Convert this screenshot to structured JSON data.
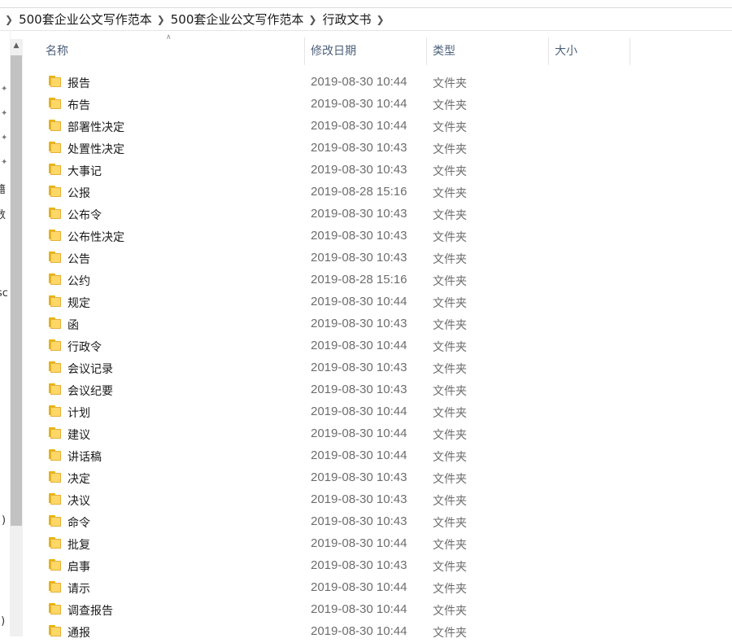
{
  "breadcrumb": {
    "items": [
      "500套企业公文写作范本",
      "500套企业公文写作范本",
      "行政文书"
    ]
  },
  "nav_pane": {
    "glyphs": [
      "籍",
      "数",
      "sc",
      ")",
      "))"
    ]
  },
  "columns": {
    "name": "名称",
    "modified": "修改日期",
    "type": "类型",
    "size": "大小"
  },
  "files": [
    {
      "name": "报告",
      "modified": "2019-08-30 10:44",
      "type": "文件夹",
      "size": ""
    },
    {
      "name": "布告",
      "modified": "2019-08-30 10:44",
      "type": "文件夹",
      "size": ""
    },
    {
      "name": "部署性决定",
      "modified": "2019-08-30 10:44",
      "type": "文件夹",
      "size": ""
    },
    {
      "name": "处置性决定",
      "modified": "2019-08-30 10:43",
      "type": "文件夹",
      "size": ""
    },
    {
      "name": "大事记",
      "modified": "2019-08-30 10:43",
      "type": "文件夹",
      "size": ""
    },
    {
      "name": "公报",
      "modified": "2019-08-28 15:16",
      "type": "文件夹",
      "size": ""
    },
    {
      "name": "公布令",
      "modified": "2019-08-30 10:43",
      "type": "文件夹",
      "size": ""
    },
    {
      "name": "公布性决定",
      "modified": "2019-08-30 10:43",
      "type": "文件夹",
      "size": ""
    },
    {
      "name": "公告",
      "modified": "2019-08-30 10:43",
      "type": "文件夹",
      "size": ""
    },
    {
      "name": "公约",
      "modified": "2019-08-28 15:16",
      "type": "文件夹",
      "size": ""
    },
    {
      "name": "规定",
      "modified": "2019-08-30 10:44",
      "type": "文件夹",
      "size": ""
    },
    {
      "name": "函",
      "modified": "2019-08-30 10:43",
      "type": "文件夹",
      "size": ""
    },
    {
      "name": "行政令",
      "modified": "2019-08-30 10:44",
      "type": "文件夹",
      "size": ""
    },
    {
      "name": "会议记录",
      "modified": "2019-08-30 10:43",
      "type": "文件夹",
      "size": ""
    },
    {
      "name": "会议纪要",
      "modified": "2019-08-30 10:43",
      "type": "文件夹",
      "size": ""
    },
    {
      "name": "计划",
      "modified": "2019-08-30 10:44",
      "type": "文件夹",
      "size": ""
    },
    {
      "name": "建议",
      "modified": "2019-08-30 10:44",
      "type": "文件夹",
      "size": ""
    },
    {
      "name": "讲话稿",
      "modified": "2019-08-30 10:44",
      "type": "文件夹",
      "size": ""
    },
    {
      "name": "决定",
      "modified": "2019-08-30 10:43",
      "type": "文件夹",
      "size": ""
    },
    {
      "name": "决议",
      "modified": "2019-08-30 10:43",
      "type": "文件夹",
      "size": ""
    },
    {
      "name": "命令",
      "modified": "2019-08-30 10:43",
      "type": "文件夹",
      "size": ""
    },
    {
      "name": "批复",
      "modified": "2019-08-30 10:44",
      "type": "文件夹",
      "size": ""
    },
    {
      "name": "启事",
      "modified": "2019-08-30 10:43",
      "type": "文件夹",
      "size": ""
    },
    {
      "name": "请示",
      "modified": "2019-08-30 10:44",
      "type": "文件夹",
      "size": ""
    },
    {
      "name": "调查报告",
      "modified": "2019-08-30 10:44",
      "type": "文件夹",
      "size": ""
    },
    {
      "name": "通报",
      "modified": "2019-08-30 10:44",
      "type": "文件夹",
      "size": ""
    }
  ]
}
